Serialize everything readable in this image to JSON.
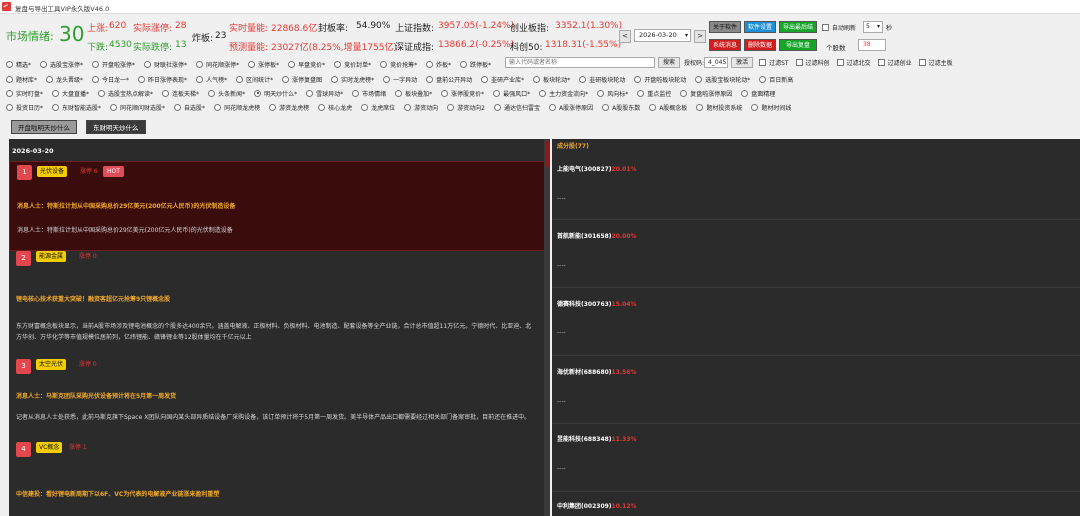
{
  "window": {
    "title": "复盘与导出工具VIP永久版V46.0"
  },
  "header": {
    "sentiment_label": "市场情绪:",
    "sentiment_value": "30",
    "up_label": "上涨:",
    "up_value": "620",
    "limit_up_label": "实际涨停:",
    "limit_up_value": "28",
    "down_label": "下跌:",
    "down_value": "4530",
    "limit_down_label": "实际跌停:",
    "limit_down_value": "13",
    "broken_label": "炸板:",
    "broken_value": "23",
    "real_vol_label": "实时量能:",
    "real_vol_value": "22868.6亿",
    "seal_rate_label": "封板率:",
    "seal_rate_value": "54.90%",
    "sh_label": "上证指数:",
    "sh_value": "3957.05(-1.24%)",
    "cy_label": "创业板指:",
    "cy_value": "3352.1(1.30%)",
    "pred_vol_label": "预测量能:",
    "pred_vol_value": "23027亿(8.25%,增量1755亿)",
    "sz_label": "深证成指:",
    "sz_value": "13866.2(-0.25%)",
    "kc_label": "科创50:",
    "kc_value": "1318.31(-1.55%)"
  },
  "date_picker": {
    "prev": "<",
    "value": "2026-03-20",
    "dropdown": "▾",
    "next": ">"
  },
  "buttons": {
    "about": "关于软件",
    "settings": "软件设置",
    "export": "导出最后结",
    "auto_refresh_label": "自动刷新",
    "auto_refresh_value": "5",
    "seconds": "秒",
    "sys_msg": "系统消息",
    "delete_data": "删除数据",
    "export_review": "导出复盘",
    "stock_count_label": "个股数",
    "stock_count_value": "38"
  },
  "filters": {
    "row1": [
      "精选*",
      "选股宝涨停*",
      "开盘啦涨停*",
      "财联社涨停*",
      "同花顺涨停*",
      "涨停板*",
      "早盘竞价*",
      "竞价封单*",
      "竞价抢筹*",
      "炸板*",
      "跌停板*"
    ],
    "search_placeholder": "输入代码或者名称",
    "search_button": "搜索",
    "auth_code_label": "授权码:",
    "auth_code_value": "4_045",
    "activate_button": "激活",
    "checks": [
      "过滤ST",
      "过滤科创",
      "过滤北交",
      "过滤创业",
      "过滤主板"
    ],
    "row2": [
      "题材库*",
      "龙头晋级*",
      "今日龙一*",
      "昨日涨停表现*",
      "人气榜*",
      "区间统计*",
      "涨停复盘图",
      "实时龙虎榜*",
      "一字异动",
      "盘前公开异动",
      "韭研产业库*",
      "板块轮动*",
      "韭研板块轮动",
      "开盘啦板块轮动",
      "选股宝板块轮动*",
      "百日新高"
    ],
    "row3": [
      "实时盯盘*",
      "大盘直播*",
      "选股宝热点解读*",
      "连板天梯*",
      "头条新闻*",
      "明天炒什么*",
      "雪球异动*",
      "市场情绪",
      "板块叠加*",
      "涨停股竞价*",
      "最强风口*",
      "主力资金流向*",
      "风向标*",
      "重点监控",
      "复盘啦涨停原因",
      "盘面精理"
    ],
    "row4": [
      "投资日历*",
      "东财智能选股*",
      "同花顺问财选股*",
      "自选股*",
      "同花顺龙虎榜",
      "游资龙虎榜",
      "核心龙虎",
      "龙虎席位",
      "游资动向",
      "游资动向2",
      "通达信扫雷宝",
      "A股涨停原因",
      "A股股东数",
      "A股概念板",
      "题材投资系统",
      "题材时间线"
    ],
    "selected": "明天炒什么*"
  },
  "tabs": {
    "tab1": "开盘啦明天炒什么",
    "tab2": "东财明天炒什么"
  },
  "left": {
    "date": "2026-03-20",
    "items": [
      {
        "rank": "1",
        "tag": "光伏设备",
        "limit": "涨停 6",
        "badge": "HOT",
        "headline": "消息人士：特斯拉计划从中国采购总价29亿美元(200亿元人民币)的光伏制造设备",
        "body": "消息人士：特斯拉计划从中国采购总价29亿美元(200亿元人民币)的光伏制造设备"
      },
      {
        "rank": "2",
        "tag": "能源金属",
        "limit": "涨停 0",
        "headline": "锂电核心技术获重大突破！融资客超亿元抢筹9只锂概念股",
        "body": "东方财富概念板块显示，当前A股市场涉及锂电池概念的个股多达400余只。涵盖电解液、正极材料、负极材料、电池制造、配套设备等全产业链，合计总市值超11万亿元。宁德时代、比亚迪、北方华创、万华化学等市值规模位居前列，亿纬锂能、赣锋锂业等12股体量均在千亿元以上"
      },
      {
        "rank": "3",
        "tag": "太空光伏",
        "limit": "涨停 0",
        "headline": "消息人士：马斯克团队采购光伏设备预计将在5月第一周发货",
        "body": "记者从消息人士处获悉，此前马斯克旗下Space X团队向国内某头部异质结设备厂采购设备，该订单预计将于5月第一周发货。美半导体产品出口都需要经过相关部门备案审批，目前还在推进中。"
      },
      {
        "rank": "4",
        "tag": "VC概念",
        "limit": "涨停 1",
        "headline": "中信建投：看好锂电新周期下以6F、VC为代表的电解液产业链涨来盈利重塑"
      }
    ]
  },
  "right": {
    "header": "成分股(77)",
    "stocks": [
      {
        "name": "上能电气(300827)",
        "pct": "20.01%",
        "detail": "----"
      },
      {
        "name": "首航新能(301658)",
        "pct": "20.00%",
        "detail": "----"
      },
      {
        "name": "德赛科技(300763)",
        "pct": "15.04%",
        "detail": "----"
      },
      {
        "name": "海优新材(688680)",
        "pct": "13.56%",
        "detail": "----"
      },
      {
        "name": "昱能科技(688348)",
        "pct": "11.33%",
        "detail": "----"
      },
      {
        "name": "中利集团(002309)",
        "pct": "10.12%"
      }
    ]
  },
  "colors": {
    "accent_red": "#e53935",
    "accent_green": "#2e9d2e",
    "panel_bg": "#2b2b2b",
    "tag_yellow": "#f3cd00"
  }
}
